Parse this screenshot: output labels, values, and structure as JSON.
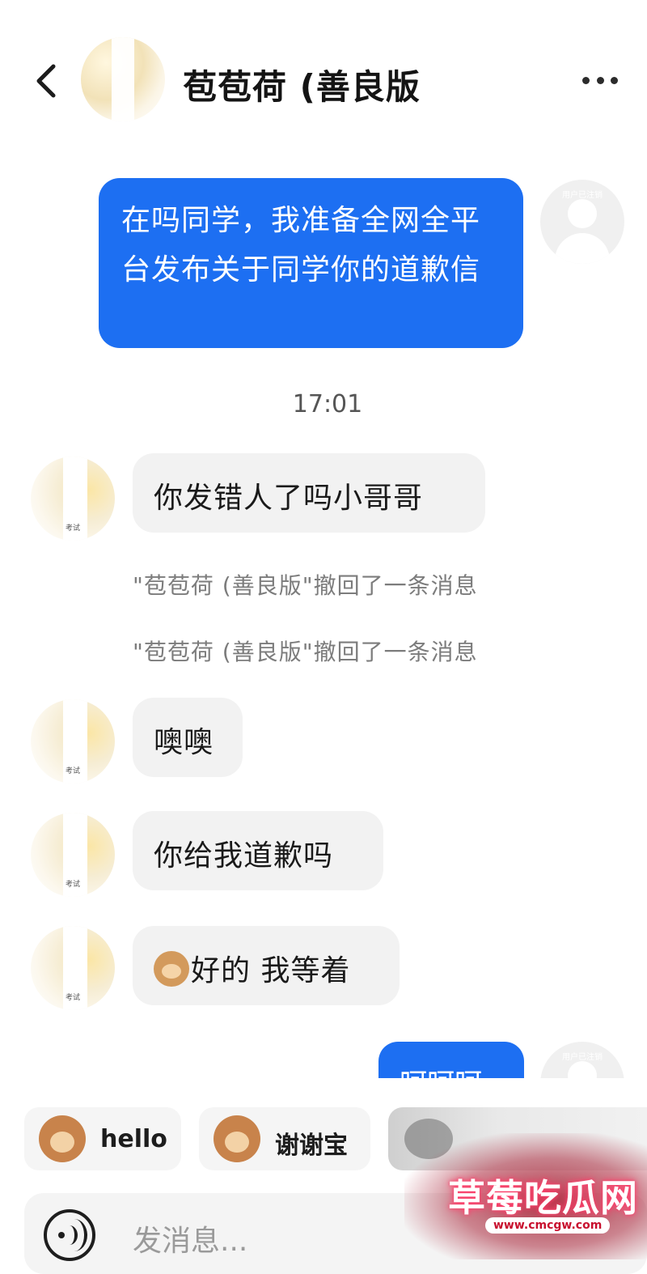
{
  "header": {
    "title": "苞苞荷 (善良版",
    "back_icon": "chevron-left-icon",
    "more_icon": "more-horizontal-icon"
  },
  "messages": [
    {
      "direction": "out",
      "text": "在吗同学，我准备全网全平台发布关于同学你的道歉信",
      "avatar_tag": "用户已注销"
    },
    {
      "type": "time",
      "text": "17:01"
    },
    {
      "direction": "in",
      "text": "你发错人了吗小哥哥",
      "avatar_tag": "考试"
    },
    {
      "type": "system",
      "text": "\"苞苞荷 (善良版\"撤回了一条消息"
    },
    {
      "type": "system",
      "text": "\"苞苞荷 (善良版\"撤回了一条消息"
    },
    {
      "direction": "in",
      "text": "噢噢",
      "avatar_tag": "考试"
    },
    {
      "direction": "in",
      "text": "你给我道歉吗",
      "avatar_tag": "考试"
    },
    {
      "direction": "in",
      "text": "好的 我等着",
      "emoji": "dog-emoji",
      "avatar_tag": "考试"
    },
    {
      "direction": "out",
      "text": "呵呵呵",
      "avatar_tag": "用户已注销"
    }
  ],
  "quick_replies": [
    {
      "label": "hello",
      "icon": "monkey-emoji-icon"
    },
    {
      "label": "谢谢宝",
      "icon": "monkey-rose-emoji-icon"
    }
  ],
  "input": {
    "placeholder": "发消息...",
    "voice_icon": "voice-icon"
  },
  "watermark": {
    "text": "草莓吃瓜网",
    "url": "www.cmcgw.com"
  },
  "colors": {
    "outgoing_bubble": "#1d6ff2",
    "incoming_bubble": "#f2f2f2",
    "system_text": "#7c7c7c"
  }
}
